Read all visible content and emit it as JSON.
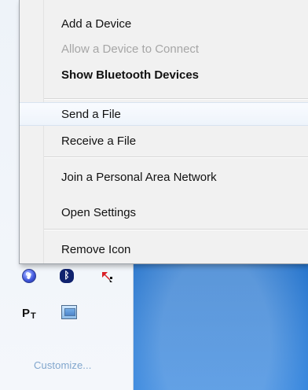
{
  "menu": {
    "items": [
      {
        "label": "Add a Device"
      },
      {
        "label": "Allow a Device to Connect"
      },
      {
        "label": "Show Bluetooth Devices"
      },
      {
        "label": "Send a File"
      },
      {
        "label": "Receive a File"
      },
      {
        "label": "Join a Personal Area Network"
      },
      {
        "label": "Open Settings"
      },
      {
        "label": "Remove Icon"
      }
    ]
  },
  "tray": {
    "icons": [
      {
        "name": "power-icon"
      },
      {
        "name": "bluetooth-icon"
      },
      {
        "name": "arrow-icon"
      },
      {
        "name": "pt-icon"
      },
      {
        "name": "monitor-icon"
      }
    ],
    "pt_label_main": "P",
    "pt_label_sub": "T",
    "customize_label": "Customize..."
  },
  "colors": {
    "desktop": "#0f62b8",
    "menu_bg": "#f1f1f1",
    "disabled_text": "#a6a6a6",
    "link": "#81a6cd"
  }
}
